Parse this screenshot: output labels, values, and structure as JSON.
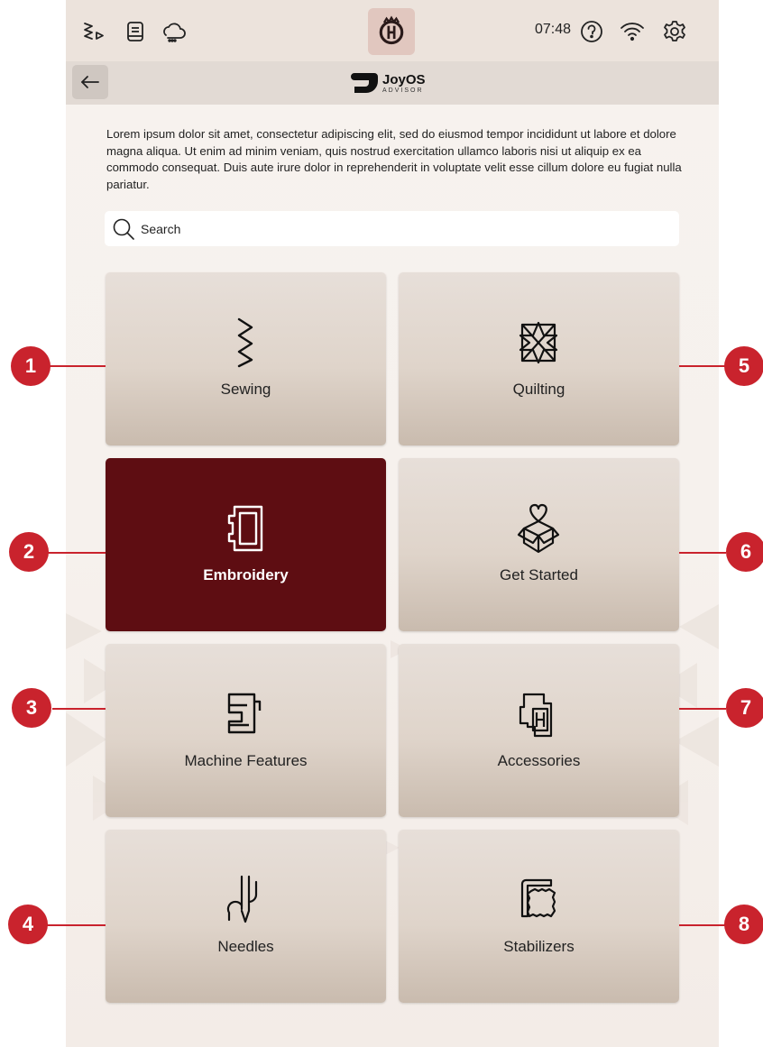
{
  "status_bar": {
    "time": "07:48",
    "icons": [
      "stitch-icon",
      "book-icon",
      "cloud-icon",
      "husqvarna-logo-icon",
      "help-icon",
      "wifi-icon",
      "settings-icon"
    ]
  },
  "header": {
    "logo_name": "JoyOS",
    "logo_sub": "ADVISOR",
    "back_icon": "arrow-left-icon"
  },
  "intro_text": "Lorem ipsum dolor sit amet, consectetur adipiscing elit, sed do eiusmod tempor incididunt ut labore et dolore magna aliqua. Ut enim ad minim veniam, quis nostrud exercitation ullamco laboris nisi ut aliquip ex ea commodo consequat. Duis aute irure dolor in reprehenderit in voluptate velit esse cillum dolore eu fugiat nulla pariatur.",
  "search": {
    "placeholder": "Search",
    "icon": "search-icon"
  },
  "categories": [
    {
      "label": "Sewing",
      "icon": "zigzag-stitch-icon",
      "callout": "1",
      "active": false
    },
    {
      "label": "Quilting",
      "icon": "quilt-star-icon",
      "callout": "5",
      "active": false
    },
    {
      "label": "Embroidery",
      "icon": "embroidery-hoop-icon",
      "callout": "2",
      "active": true
    },
    {
      "label": "Get Started",
      "icon": "gift-box-heart-icon",
      "callout": "6",
      "active": false
    },
    {
      "label": "Machine Features",
      "icon": "sewing-machine-icon",
      "callout": "3",
      "active": false
    },
    {
      "label": "Accessories",
      "icon": "presser-feet-icon",
      "callout": "7",
      "active": false
    },
    {
      "label": "Needles",
      "icon": "needle-threader-icon",
      "callout": "4",
      "active": false
    },
    {
      "label": "Stabilizers",
      "icon": "stabilizer-fabric-icon",
      "callout": "8",
      "active": false
    }
  ],
  "colors": {
    "accent_active_tile": "#5e0d12",
    "callout_red": "#c9232d",
    "status_bar_bg": "#ece3dc",
    "header_bg": "#e2dad4"
  }
}
